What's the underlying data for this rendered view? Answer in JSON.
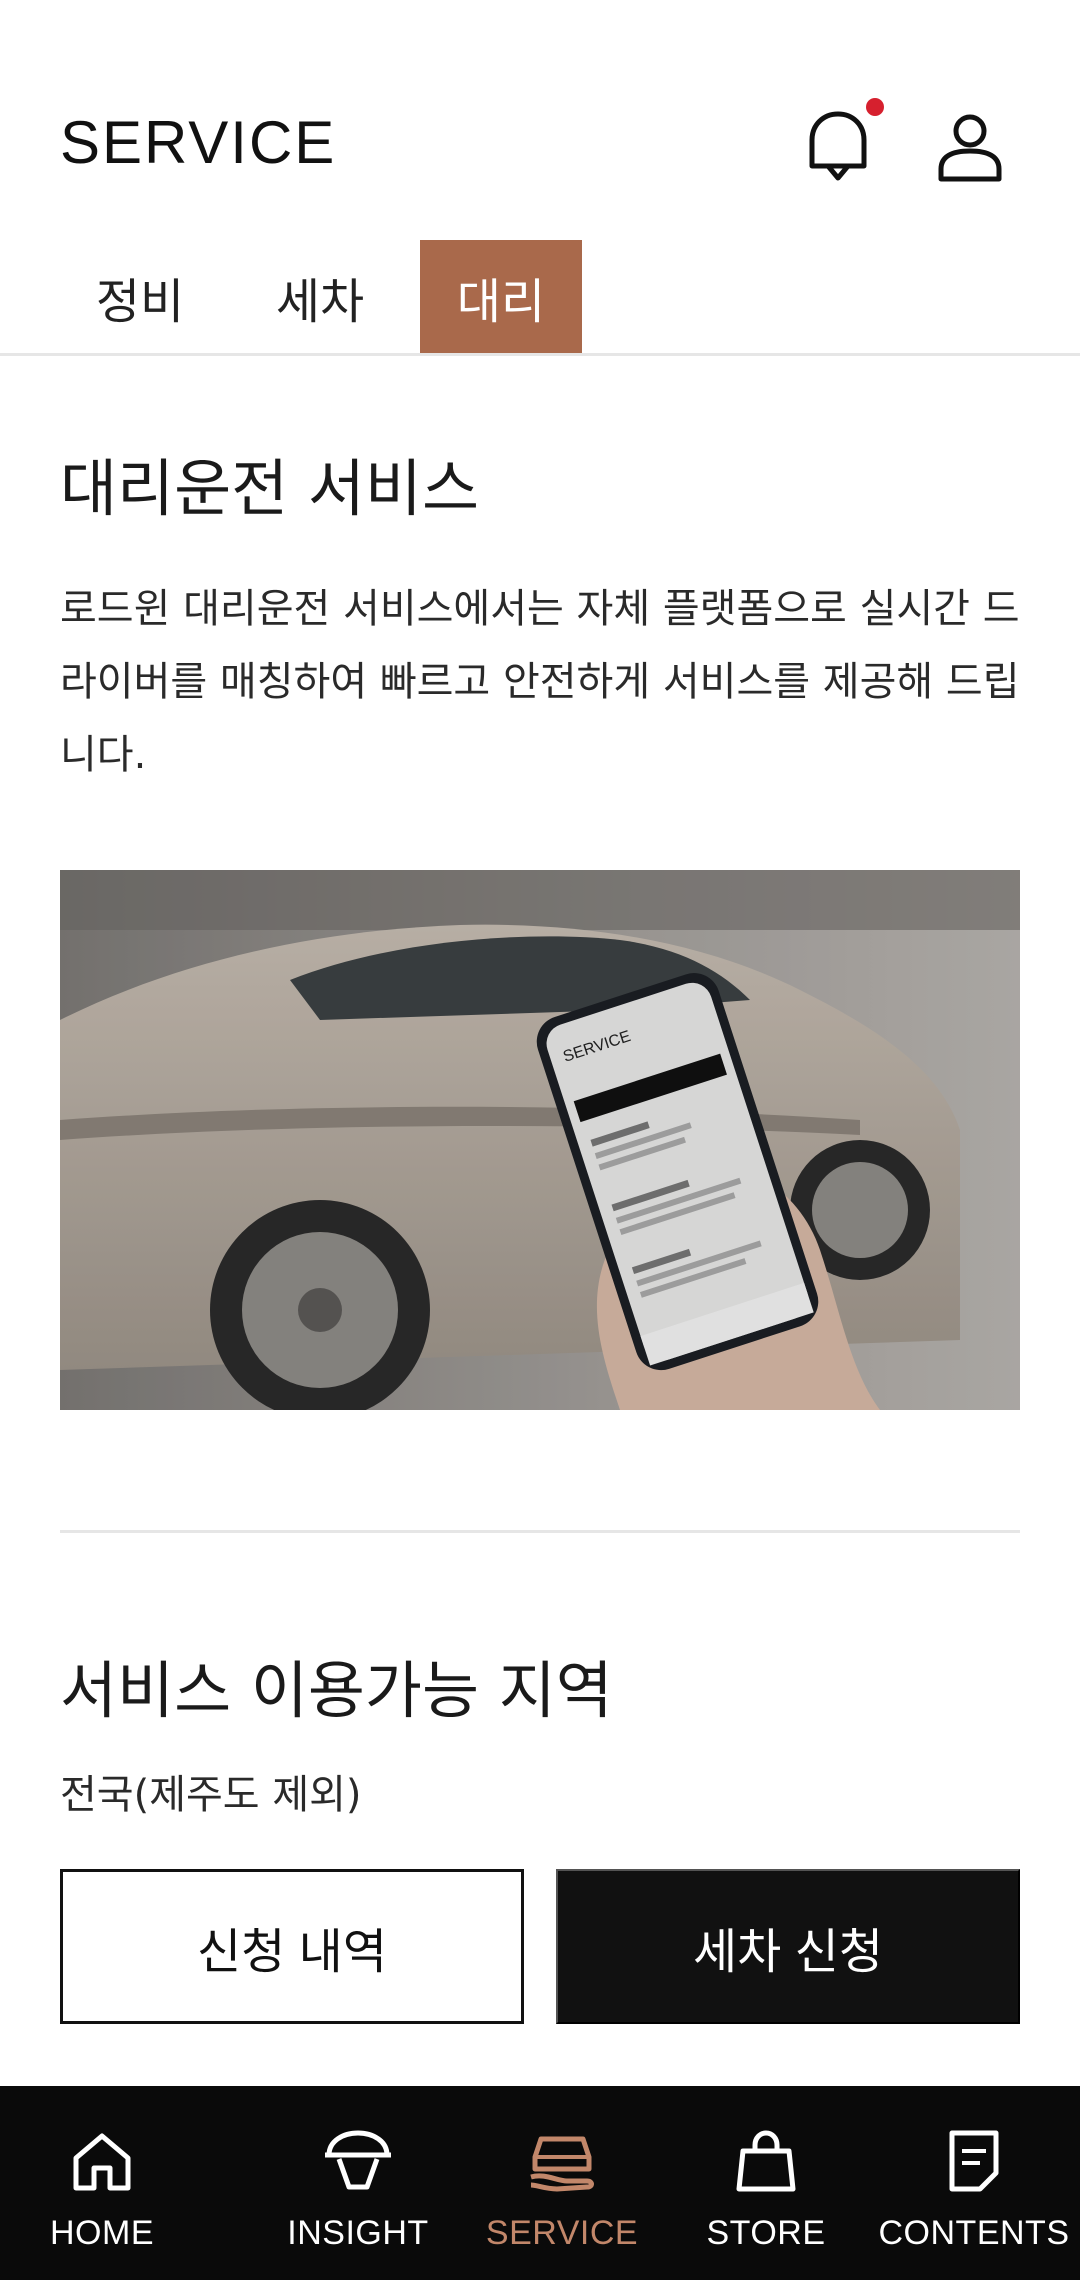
{
  "header": {
    "title": "SERVICE",
    "bell_icon": "bell-icon",
    "user_icon": "user-icon",
    "notification_color": "#d6202e"
  },
  "tabs": [
    {
      "label": "정비",
      "active": false
    },
    {
      "label": "세차",
      "active": false
    },
    {
      "label": "대리",
      "active": true
    }
  ],
  "intro": {
    "title": "대리운전 서비스",
    "description": "로드윈 대리운전 서비스에서는 자체 플랫폼으로 실시간 드라이버를 매칭하여 빠르고 안전하게 서비스를 제공해 드립니다."
  },
  "hero_image": {
    "subject": "car-and-phone-photo",
    "phone_screen_title": "SERVICE"
  },
  "area": {
    "title": "서비스 이용가능 지역",
    "value": "전국(제주도 제외)"
  },
  "actions": {
    "history_label": "신청 내역",
    "apply_label": "세차 신청"
  },
  "bottom_nav": [
    {
      "label": "HOME",
      "icon": "home-icon",
      "active": false
    },
    {
      "label": "INSIGHT",
      "icon": "insight-icon",
      "active": false
    },
    {
      "label": "SERVICE",
      "icon": "service-car-icon",
      "active": true
    },
    {
      "label": "STORE",
      "icon": "shopping-bag-icon",
      "active": false
    },
    {
      "label": "CONTENTS",
      "icon": "document-icon",
      "active": false
    }
  ],
  "colors": {
    "accent": "#a9694b",
    "active_nav": "#c2876a",
    "dark": "#111111"
  }
}
